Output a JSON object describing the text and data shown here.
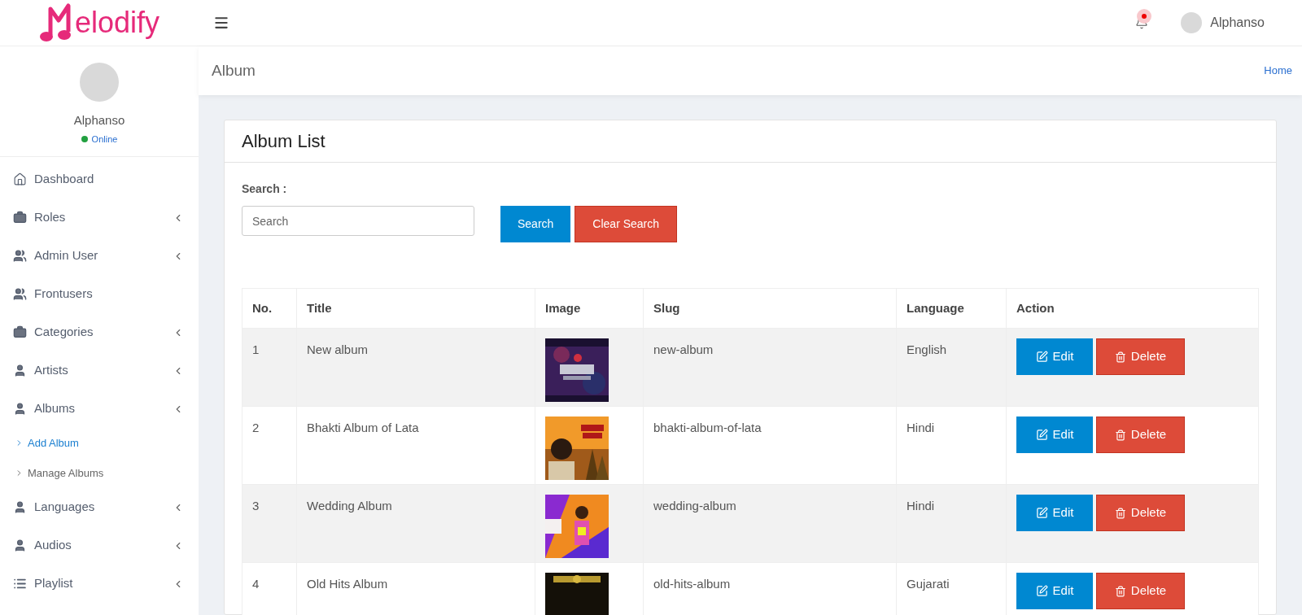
{
  "logo": {
    "text": "elodify"
  },
  "topbar": {
    "user": "Alphanso",
    "notification": true
  },
  "sidebar": {
    "user": {
      "name": "Alphanso",
      "status": "Online"
    },
    "items": [
      {
        "label": "Dashboard",
        "kind": "home",
        "has_arrow": false
      },
      {
        "label": "Roles",
        "kind": "briefcase",
        "has_arrow": true
      },
      {
        "label": "Admin User",
        "kind": "users",
        "has_arrow": true
      },
      {
        "label": "Frontusers",
        "kind": "users",
        "has_arrow": false
      },
      {
        "label": "Categories",
        "kind": "briefcase",
        "has_arrow": true
      },
      {
        "label": "Artists",
        "kind": "person",
        "has_arrow": true
      },
      {
        "label": "Albums",
        "kind": "person",
        "has_arrow": true,
        "children": [
          {
            "label": "Add Album",
            "selected": true
          },
          {
            "label": "Manage Albums",
            "selected": false
          }
        ]
      },
      {
        "label": "Languages",
        "kind": "person",
        "has_arrow": true
      },
      {
        "label": "Audios",
        "kind": "person",
        "has_arrow": true
      },
      {
        "label": "Playlist",
        "kind": "list",
        "has_arrow": true
      }
    ]
  },
  "page_header": {
    "title": "Album",
    "breadcrumb": "Home"
  },
  "card": {
    "title": "Album List",
    "search_label": "Search :",
    "search": {
      "placeholder": "Search"
    },
    "buttons": [
      {
        "label": "Search",
        "kind": "primary"
      },
      {
        "label": "Clear Search",
        "kind": "danger"
      }
    ]
  },
  "table": {
    "columns": [
      "No.",
      "Title",
      "Image",
      "Slug",
      "Language",
      "Action"
    ],
    "rows": [
      {
        "no": "1",
        "title": "New album",
        "slug": "new-album",
        "language": "English",
        "actions": [
          "Edit",
          "Delete"
        ]
      },
      {
        "no": "2",
        "title": "Bhakti Album of Lata",
        "slug": "bhakti-album-of-lata",
        "language": "Hindi",
        "actions": [
          "Edit",
          "Delete"
        ]
      },
      {
        "no": "3",
        "title": "Wedding Album",
        "slug": "wedding-album",
        "language": "Hindi",
        "actions": [
          "Edit",
          "Delete"
        ]
      },
      {
        "no": "4",
        "title": "Old Hits Album",
        "slug": "old-hits-album",
        "language": "Gujarati",
        "actions": [
          "Edit",
          "Delete"
        ]
      }
    ]
  }
}
